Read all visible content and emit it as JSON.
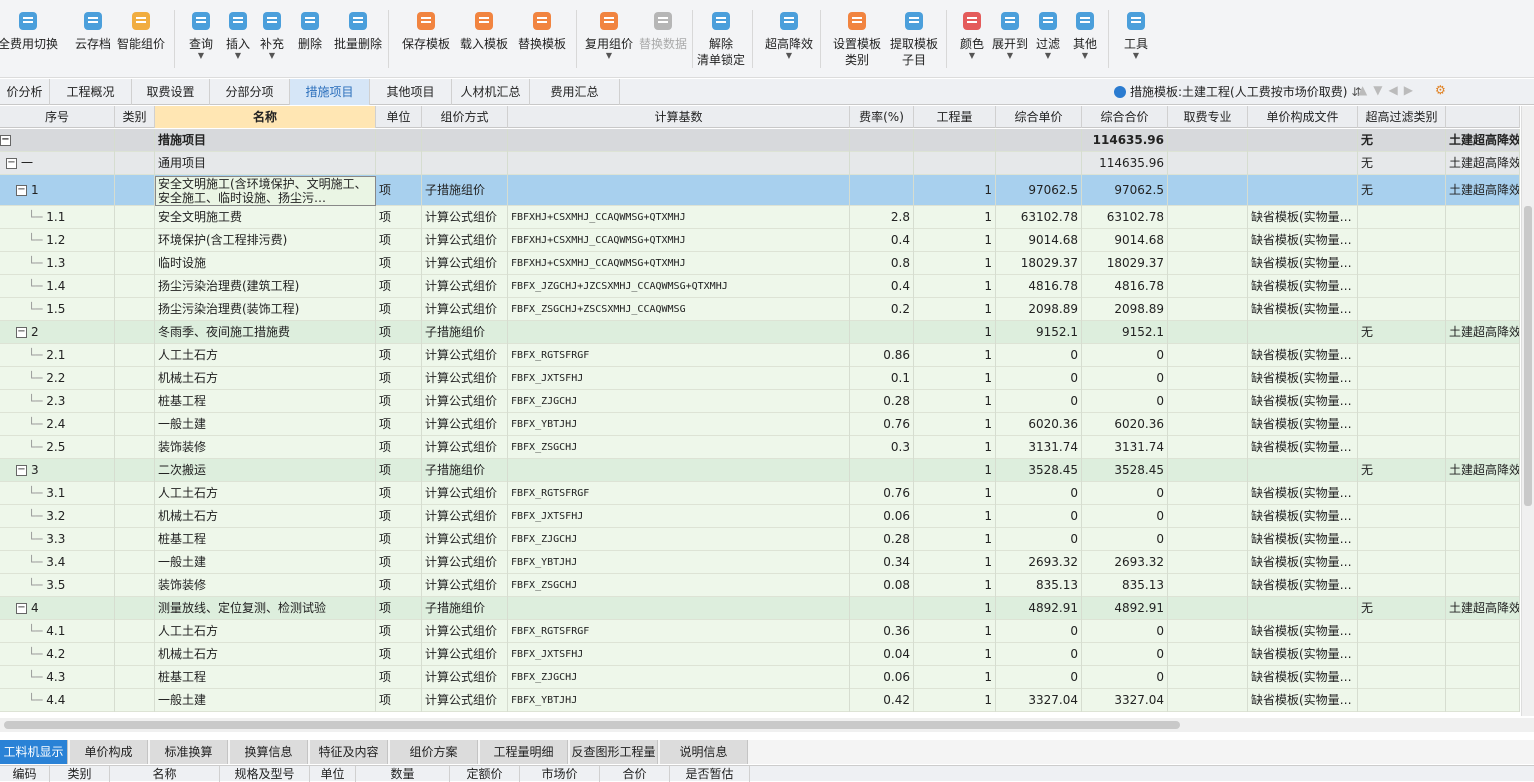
{
  "toolbar": {
    "items": [
      {
        "label": "全费用切换",
        "icon": "calculator-icon",
        "color": "#2d8fd6"
      },
      {
        "label": "云存档",
        "icon": "cloud-upload-icon",
        "color": "#2d8fd6"
      },
      {
        "label": "智能组价",
        "icon": "smart-price-icon",
        "color": "#f0a020"
      },
      {
        "label": "查询",
        "icon": "search-doc-icon",
        "color": "#2d8fd6"
      },
      {
        "label": "插入",
        "icon": "insert-icon",
        "color": "#2d8fd6"
      },
      {
        "label": "补充",
        "icon": "add-icon",
        "color": "#2d8fd6"
      },
      {
        "label": "删除",
        "icon": "trash-icon",
        "color": "#2d8fd6"
      },
      {
        "label": "批量删除",
        "icon": "batch-delete-icon",
        "color": "#2d8fd6"
      },
      {
        "label": "保存模板",
        "icon": "save-template-icon",
        "color": "#f07020"
      },
      {
        "label": "载入模板",
        "icon": "load-template-icon",
        "color": "#f07020"
      },
      {
        "label": "替换模板",
        "icon": "replace-template-icon",
        "color": "#f07020"
      },
      {
        "label": "复用组价",
        "icon": "reuse-icon",
        "color": "#f07020"
      },
      {
        "label": "替换数据",
        "icon": "replace-data-icon",
        "color": "#aaaaaa"
      },
      {
        "label": "解除",
        "label2": "清单锁定",
        "icon": "unlock-icon",
        "color": "#2d8fd6"
      },
      {
        "label": "超高降效",
        "icon": "building-icon",
        "color": "#2d8fd6"
      },
      {
        "label": "设置模板",
        "label2": "类别",
        "icon": "template-category-icon",
        "color": "#f07020"
      },
      {
        "label": "提取模板",
        "label2": "子目",
        "icon": "extract-template-icon",
        "color": "#2d8fd6"
      },
      {
        "label": "颜色",
        "icon": "paint-bucket-icon",
        "color": "#e04040"
      },
      {
        "label": "展开到",
        "icon": "tree-expand-icon",
        "color": "#2d8fd6"
      },
      {
        "label": "过滤",
        "icon": "filter-icon",
        "color": "#2d8fd6"
      },
      {
        "label": "其他",
        "icon": "grid-icon",
        "color": "#2d8fd6"
      },
      {
        "label": "工具",
        "icon": "tools-icon",
        "color": "#2d8fd6"
      }
    ]
  },
  "tabs": [
    "价分析",
    "工程概况",
    "取费设置",
    "分部分项",
    "措施项目",
    "其他项目",
    "人材机汇总",
    "费用汇总"
  ],
  "active_tab": "措施项目",
  "template_label": "措施模板:土建工程(人工费按市场价取费)",
  "columns": [
    "序号",
    "类别",
    "名称",
    "单位",
    "组价方式",
    "计算基数",
    "费率(%)",
    "工程量",
    "综合单价",
    "综合合价",
    "取费专业",
    "单价构成文件",
    "超高过滤类别",
    ""
  ],
  "rows": [
    {
      "kind": "lvl0",
      "seq": "",
      "name": "措施项目",
      "unit": "",
      "method": "",
      "base": "",
      "rate": "",
      "qty": "",
      "price": "",
      "total": "114635.96",
      "file": "",
      "filter": "无",
      "extra": "土建超高降效"
    },
    {
      "kind": "lvl1",
      "seq": "一",
      "name": "通用项目",
      "unit": "",
      "method": "",
      "base": "",
      "rate": "",
      "qty": "",
      "price": "",
      "total": "114635.96",
      "file": "",
      "filter": "无",
      "extra": "土建超高降效"
    },
    {
      "kind": "cur",
      "seq": "1",
      "name": "安全文明施工(含环境保护、文明施工、安全施工、临时设施、扬尘污…",
      "unit": "项",
      "method": "子措施组价",
      "base": "",
      "rate": "",
      "qty": "1",
      "price": "97062.5",
      "total": "97062.5",
      "file": "",
      "filter": "无",
      "extra": "土建超高降效"
    },
    {
      "kind": "sub",
      "seq": "1.1",
      "name": "安全文明施工费",
      "unit": "项",
      "method": "计算公式组价",
      "base": "FBFXHJ+CSXMHJ_CCAQWMSG+QTXMHJ",
      "rate": "2.8",
      "qty": "1",
      "price": "63102.78",
      "total": "63102.78",
      "file": "缺省模板(实物量…",
      "filter": "",
      "extra": ""
    },
    {
      "kind": "sub",
      "seq": "1.2",
      "name": "环境保护(含工程排污费)",
      "unit": "项",
      "method": "计算公式组价",
      "base": "FBFXHJ+CSXMHJ_CCAQWMSG+QTXMHJ",
      "rate": "0.4",
      "qty": "1",
      "price": "9014.68",
      "total": "9014.68",
      "file": "缺省模板(实物量…",
      "filter": "",
      "extra": ""
    },
    {
      "kind": "sub",
      "seq": "1.3",
      "name": "临时设施",
      "unit": "项",
      "method": "计算公式组价",
      "base": "FBFXHJ+CSXMHJ_CCAQWMSG+QTXMHJ",
      "rate": "0.8",
      "qty": "1",
      "price": "18029.37",
      "total": "18029.37",
      "file": "缺省模板(实物量…",
      "filter": "",
      "extra": ""
    },
    {
      "kind": "sub",
      "seq": "1.4",
      "name": "扬尘污染治理费(建筑工程)",
      "unit": "项",
      "method": "计算公式组价",
      "base": "FBFX_JZGCHJ+JZCSXMHJ_CCAQWMSG+QTXMHJ",
      "rate": "0.4",
      "qty": "1",
      "price": "4816.78",
      "total": "4816.78",
      "file": "缺省模板(实物量…",
      "filter": "",
      "extra": ""
    },
    {
      "kind": "sub",
      "seq": "1.5",
      "name": "扬尘污染治理费(装饰工程)",
      "unit": "项",
      "method": "计算公式组价",
      "base": "FBFX_ZSGCHJ+ZSCSXMHJ_CCAQWMSG",
      "rate": "0.2",
      "qty": "1",
      "price": "2098.89",
      "total": "2098.89",
      "file": "缺省模板(实物量…",
      "filter": "",
      "extra": ""
    },
    {
      "kind": "grp",
      "seq": "2",
      "name": "冬雨季、夜间施工措施费",
      "unit": "项",
      "method": "子措施组价",
      "base": "",
      "rate": "",
      "qty": "1",
      "price": "9152.1",
      "total": "9152.1",
      "file": "",
      "filter": "无",
      "extra": "土建超高降效"
    },
    {
      "kind": "sub",
      "seq": "2.1",
      "name": "人工土石方",
      "unit": "项",
      "method": "计算公式组价",
      "base": "FBFX_RGTSFRGF",
      "rate": "0.86",
      "qty": "1",
      "price": "0",
      "total": "0",
      "file": "缺省模板(实物量…",
      "filter": "",
      "extra": ""
    },
    {
      "kind": "sub",
      "seq": "2.2",
      "name": "机械土石方",
      "unit": "项",
      "method": "计算公式组价",
      "base": "FBFX_JXTSFHJ",
      "rate": "0.1",
      "qty": "1",
      "price": "0",
      "total": "0",
      "file": "缺省模板(实物量…",
      "filter": "",
      "extra": ""
    },
    {
      "kind": "sub",
      "seq": "2.3",
      "name": "桩基工程",
      "unit": "项",
      "method": "计算公式组价",
      "base": "FBFX_ZJGCHJ",
      "rate": "0.28",
      "qty": "1",
      "price": "0",
      "total": "0",
      "file": "缺省模板(实物量…",
      "filter": "",
      "extra": ""
    },
    {
      "kind": "sub",
      "seq": "2.4",
      "name": "一般土建",
      "unit": "项",
      "method": "计算公式组价",
      "base": "FBFX_YBTJHJ",
      "rate": "0.76",
      "qty": "1",
      "price": "6020.36",
      "total": "6020.36",
      "file": "缺省模板(实物量…",
      "filter": "",
      "extra": ""
    },
    {
      "kind": "sub",
      "seq": "2.5",
      "name": "装饰装修",
      "unit": "项",
      "method": "计算公式组价",
      "base": "FBFX_ZSGCHJ",
      "rate": "0.3",
      "qty": "1",
      "price": "3131.74",
      "total": "3131.74",
      "file": "缺省模板(实物量…",
      "filter": "",
      "extra": ""
    },
    {
      "kind": "grp",
      "seq": "3",
      "name": "二次搬运",
      "unit": "项",
      "method": "子措施组价",
      "base": "",
      "rate": "",
      "qty": "1",
      "price": "3528.45",
      "total": "3528.45",
      "file": "",
      "filter": "无",
      "extra": "土建超高降效"
    },
    {
      "kind": "sub",
      "seq": "3.1",
      "name": "人工土石方",
      "unit": "项",
      "method": "计算公式组价",
      "base": "FBFX_RGTSFRGF",
      "rate": "0.76",
      "qty": "1",
      "price": "0",
      "total": "0",
      "file": "缺省模板(实物量…",
      "filter": "",
      "extra": ""
    },
    {
      "kind": "sub",
      "seq": "3.2",
      "name": "机械土石方",
      "unit": "项",
      "method": "计算公式组价",
      "base": "FBFX_JXTSFHJ",
      "rate": "0.06",
      "qty": "1",
      "price": "0",
      "total": "0",
      "file": "缺省模板(实物量…",
      "filter": "",
      "extra": ""
    },
    {
      "kind": "sub",
      "seq": "3.3",
      "name": "桩基工程",
      "unit": "项",
      "method": "计算公式组价",
      "base": "FBFX_ZJGCHJ",
      "rate": "0.28",
      "qty": "1",
      "price": "0",
      "total": "0",
      "file": "缺省模板(实物量…",
      "filter": "",
      "extra": ""
    },
    {
      "kind": "sub",
      "seq": "3.4",
      "name": "一般土建",
      "unit": "项",
      "method": "计算公式组价",
      "base": "FBFX_YBTJHJ",
      "rate": "0.34",
      "qty": "1",
      "price": "2693.32",
      "total": "2693.32",
      "file": "缺省模板(实物量…",
      "filter": "",
      "extra": ""
    },
    {
      "kind": "sub",
      "seq": "3.5",
      "name": "装饰装修",
      "unit": "项",
      "method": "计算公式组价",
      "base": "FBFX_ZSGCHJ",
      "rate": "0.08",
      "qty": "1",
      "price": "835.13",
      "total": "835.13",
      "file": "缺省模板(实物量…",
      "filter": "",
      "extra": ""
    },
    {
      "kind": "grp",
      "seq": "4",
      "name": "测量放线、定位复测、检测试验",
      "unit": "项",
      "method": "子措施组价",
      "base": "",
      "rate": "",
      "qty": "1",
      "price": "4892.91",
      "total": "4892.91",
      "file": "",
      "filter": "无",
      "extra": "土建超高降效"
    },
    {
      "kind": "sub",
      "seq": "4.1",
      "name": "人工土石方",
      "unit": "项",
      "method": "计算公式组价",
      "base": "FBFX_RGTSFRGF",
      "rate": "0.36",
      "qty": "1",
      "price": "0",
      "total": "0",
      "file": "缺省模板(实物量…",
      "filter": "",
      "extra": ""
    },
    {
      "kind": "sub",
      "seq": "4.2",
      "name": "机械土石方",
      "unit": "项",
      "method": "计算公式组价",
      "base": "FBFX_JXTSFHJ",
      "rate": "0.04",
      "qty": "1",
      "price": "0",
      "total": "0",
      "file": "缺省模板(实物量…",
      "filter": "",
      "extra": ""
    },
    {
      "kind": "sub",
      "seq": "4.3",
      "name": "桩基工程",
      "unit": "项",
      "method": "计算公式组价",
      "base": "FBFX_ZJGCHJ",
      "rate": "0.06",
      "qty": "1",
      "price": "0",
      "total": "0",
      "file": "缺省模板(实物量…",
      "filter": "",
      "extra": ""
    },
    {
      "kind": "sub",
      "seq": "4.4",
      "name": "一般土建",
      "unit": "项",
      "method": "计算公式组价",
      "base": "FBFX_YBTJHJ",
      "rate": "0.42",
      "qty": "1",
      "price": "3327.04",
      "total": "3327.04",
      "file": "缺省模板(实物量…",
      "filter": "",
      "extra": ""
    }
  ],
  "bottom_tabs": [
    "工料机显示",
    "单价构成",
    "标准换算",
    "换算信息",
    "特征及内容",
    "组价方案",
    "工程量明细",
    "反查图形工程量",
    "说明信息"
  ],
  "active_bottom_tab": "工料机显示",
  "bottom_columns": [
    "编码",
    "类别",
    "名称",
    "规格及型号",
    "单位",
    "数量",
    "定额价",
    "市场价",
    "合价",
    "是否暂估"
  ]
}
